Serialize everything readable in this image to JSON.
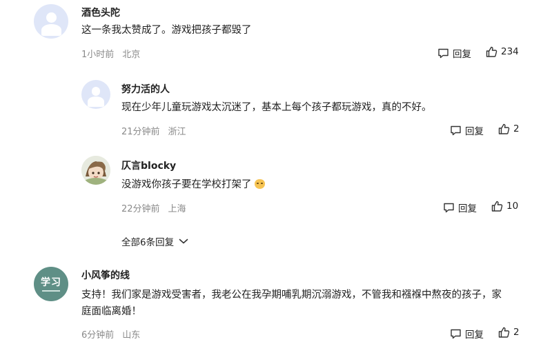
{
  "comments": [
    {
      "user": "酒色头陀",
      "text": "这一条我太赞成了。游戏把孩子都毁了",
      "time": "1小时前",
      "location": "北京",
      "reply_label": "回复",
      "likes": "234",
      "avatar": "default-avatar"
    },
    {
      "user": "努力活的人",
      "text": "现在少年儿童玩游戏太沉迷了，基本上每个孩子都玩游戏，真的不好。",
      "time": "21分钟前",
      "location": "浙江",
      "reply_label": "回复",
      "likes": "2",
      "avatar": "default-avatar"
    },
    {
      "user": "仄言blocky",
      "text": "没游戏你孩子要在学校打架了",
      "time": "22分钟前",
      "location": "上海",
      "reply_label": "回复",
      "likes": "10",
      "avatar": "cartoon-avatar",
      "emoji": "smile-emoji"
    },
    {
      "user": "小风筝的线",
      "text_line1": "支持！我们家是游戏受害者，我老公在我孕期哺乳期沉溺游戏，不管我和襁褓中熬夜的孩子，家",
      "text_line2": "庭面临离婚！",
      "time": "6分钟前",
      "location": "山东",
      "reply_label": "回复",
      "likes": "2",
      "avatar": "study-avatar",
      "avatar_text": "学习"
    }
  ],
  "expand_replies": "全部6条回复",
  "icons": {
    "reply": "comment-bubble-icon",
    "like": "thumbs-up-icon",
    "expand": "chevron-down-icon"
  },
  "colors": {
    "meta": "#8a8a8a",
    "text": "#222222",
    "default_avatar": "#dfe6f8",
    "study_avatar": "#5f8f86"
  }
}
